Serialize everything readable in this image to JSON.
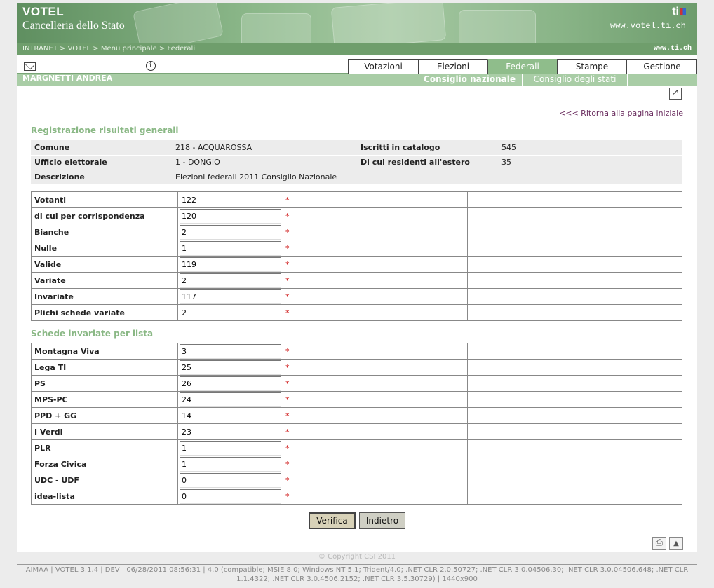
{
  "header": {
    "app_name": "VOTEL",
    "subtitle": "Cancelleria dello Stato",
    "site_url": "www.votel.ti.ch",
    "logo_text": "ti",
    "breadcrumb": "INTRANET > VOTEL > Menu principale > Federali",
    "ti_url": "www.ti.ch"
  },
  "tabs": [
    {
      "label": "Votazioni"
    },
    {
      "label": "Elezioni"
    },
    {
      "label": "Federali"
    },
    {
      "label": "Stampe"
    },
    {
      "label": "Gestione"
    }
  ],
  "subbar": {
    "user": "MARGNETTI ANDREA",
    "subtabs": [
      {
        "label": "Consiglio nazionale"
      },
      {
        "label": "Consiglio degli stati"
      }
    ]
  },
  "home_link": "<<< Ritorna alla pagina iniziale",
  "general": {
    "title": "Registrazione risultati generali",
    "comune_label": "Comune",
    "comune_value": "218 - ACQUAROSSA",
    "iscritti_label": "Iscritti in catalogo",
    "iscritti_value": "545",
    "ufficio_label": "Ufficio elettorale",
    "ufficio_value": "1 - DONGIO",
    "residenti_label": "Di cui residenti all'estero",
    "residenti_value": "35",
    "descrizione_label": "Descrizione",
    "descrizione_value": "Elezioni federali 2011 Consiglio Nazionale"
  },
  "results": [
    {
      "label": "Votanti",
      "value": "122"
    },
    {
      "label": "di cui per corrispondenza",
      "value": "120"
    },
    {
      "label": "Bianche",
      "value": "2"
    },
    {
      "label": "Nulle",
      "value": "1"
    },
    {
      "label": "Valide",
      "value": "119"
    },
    {
      "label": "Variate",
      "value": "2"
    },
    {
      "label": "Invariate",
      "value": "117"
    },
    {
      "label": "Plichi schede variate",
      "value": "2"
    }
  ],
  "lists_title": "Schede invariate per lista",
  "lists": [
    {
      "label": "Montagna Viva",
      "value": "3"
    },
    {
      "label": "Lega TI",
      "value": "25"
    },
    {
      "label": "PS",
      "value": "26"
    },
    {
      "label": "MPS-PC",
      "value": "24"
    },
    {
      "label": "PPD + GG",
      "value": "14"
    },
    {
      "label": "I Verdi",
      "value": "23"
    },
    {
      "label": "PLR",
      "value": "1"
    },
    {
      "label": "Forza Civica",
      "value": "1"
    },
    {
      "label": "UDC - UDF",
      "value": "0"
    },
    {
      "label": "idea-lista",
      "value": "0"
    }
  ],
  "required_mark": "*",
  "buttons": {
    "verify": "Verifica",
    "back": "Indietro"
  },
  "copyright": "© Copyright CSI 2011",
  "footer": "AIMAA | VOTEL 3.1.4 | DEV | 06/28/2011 08:56:31 | 4.0 (compatible; MSIE 8.0; Windows NT 5.1; Trident/4.0; .NET CLR 2.0.50727; .NET CLR 3.0.04506.30; .NET CLR 3.0.04506.648; .NET CLR 1.1.4322; .NET CLR 3.0.4506.2152; .NET CLR 3.5.30729) | 1440x900",
  "colors": {
    "accent_green": "#8fbd8b",
    "section_title": "#8ab885",
    "link": "#6a2d5f",
    "required": "#d02020"
  }
}
